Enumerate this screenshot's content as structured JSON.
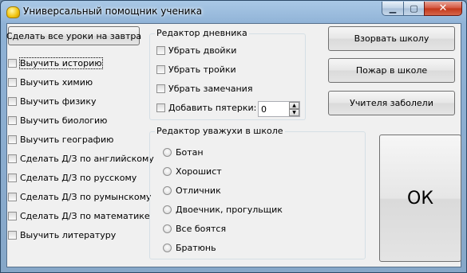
{
  "window": {
    "title": "Универсальный помощник ученика",
    "controls": {
      "minimize": "▁",
      "maximize": "▢",
      "close": "✕"
    }
  },
  "left": {
    "do_all_button": "Сделать все уроки на завтра",
    "tasks": [
      "Выучить историю",
      "Выучить химию",
      "Выучить физику",
      "Выучить биологию",
      "Выучить географию",
      "Сделать Д/З по английскому",
      "Сделать Д/З по русскому",
      "Сделать Д/З по румынскому",
      "Сделать Д/З по математике",
      "Выучить литературу"
    ]
  },
  "diary": {
    "title": "Редактор дневника",
    "options": [
      "Убрать двойки",
      "Убрать тройки",
      "Убрать замечания",
      "Добавить пятерки:"
    ],
    "fives_value": "0"
  },
  "respect": {
    "title": "Редактор уважухи в школе",
    "options": [
      "Ботан",
      "Хорошист",
      "Отличник",
      "Двоечник, прогульщик",
      "Все боятся",
      "Братюнь"
    ]
  },
  "actions": {
    "blow_up": "Взорвать школу",
    "fire": "Пожар в школе",
    "teachers_sick": "Учителя заболели",
    "ok": "ОК"
  }
}
